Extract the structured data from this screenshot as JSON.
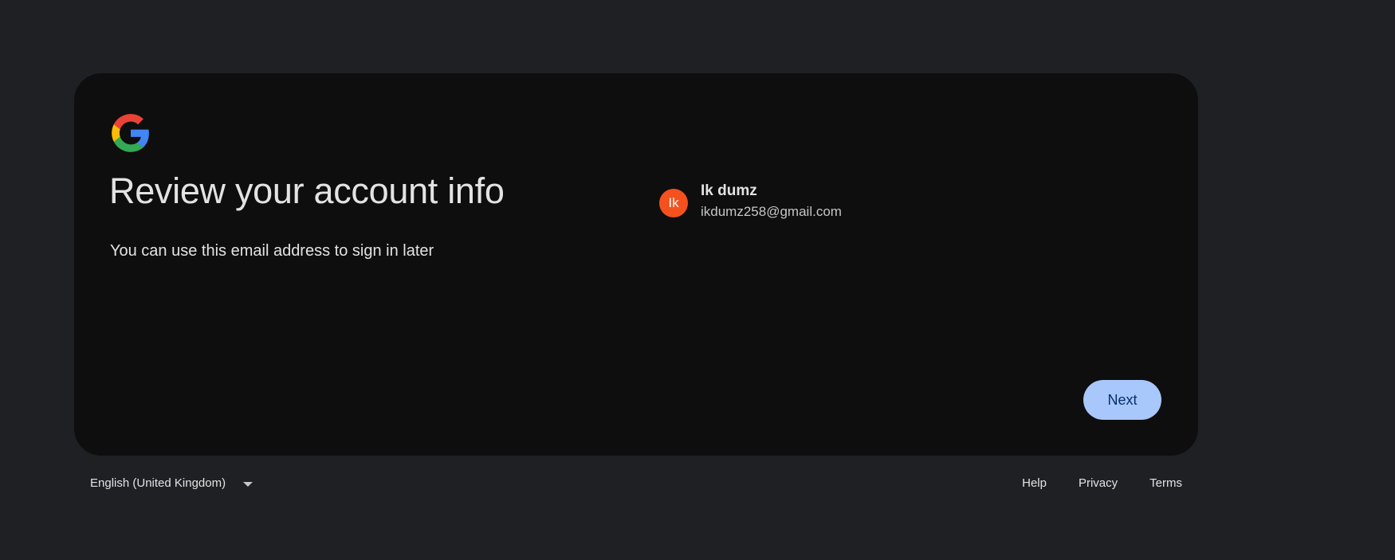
{
  "card": {
    "title": "Review your account info",
    "subtitle": "You can use this email address to sign in later"
  },
  "account": {
    "initials": "Ik",
    "name": "Ik dumz",
    "email": "ikdumz258@gmail.com",
    "avatar_color": "#f4511e"
  },
  "actions": {
    "next_label": "Next",
    "next_color": "#a8c7fa"
  },
  "footer": {
    "language": "English (United Kingdom)",
    "links": [
      "Help",
      "Privacy",
      "Terms"
    ]
  },
  "icons": {
    "logo": "google-logo-icon",
    "language_dropdown": "chevron-down-icon"
  }
}
